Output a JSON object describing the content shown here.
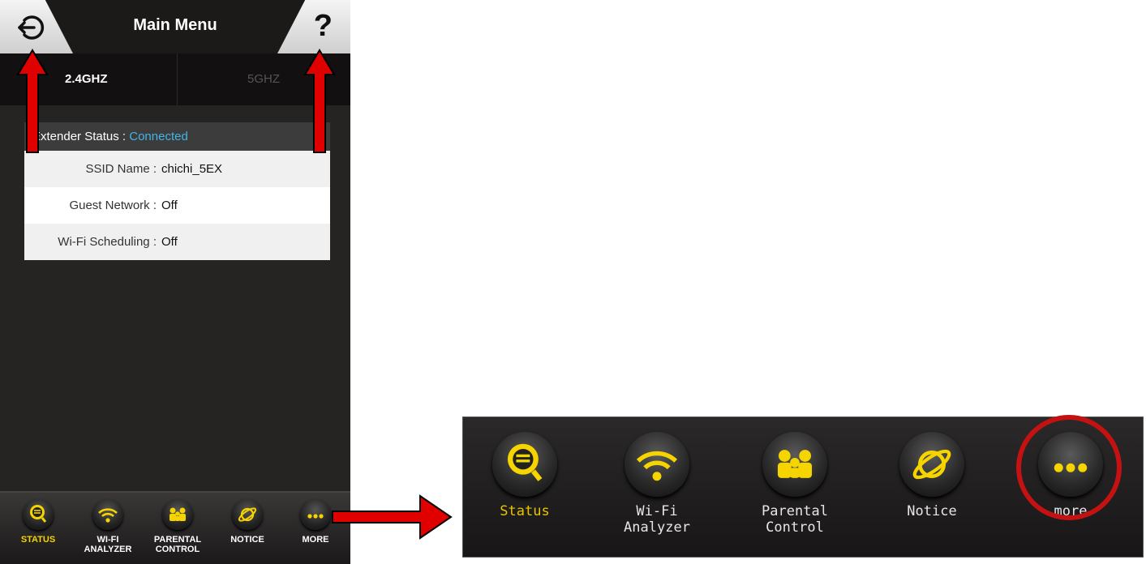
{
  "header": {
    "title": "Main Menu",
    "help_glyph": "?"
  },
  "bands": {
    "band1": "2.4GHZ",
    "band2": "5GHZ"
  },
  "status": {
    "heading_label": "Extender Status :",
    "heading_value": "Connected",
    "rows": [
      {
        "label": "SSID Name :",
        "value": "chichi_5EX"
      },
      {
        "label": "Guest Network :",
        "value": "Off"
      },
      {
        "label": "Wi-Fi Scheduling :",
        "value": "Off"
      }
    ]
  },
  "phone_nav": [
    {
      "label1": "STATUS",
      "label2": ""
    },
    {
      "label1": "WI-FI",
      "label2": "ANALYZER"
    },
    {
      "label1": "PARENTAL",
      "label2": "CONTROL"
    },
    {
      "label1": "NOTICE",
      "label2": ""
    },
    {
      "label1": "MORE",
      "label2": ""
    }
  ],
  "zoom_nav": [
    {
      "label1": "Status",
      "label2": ""
    },
    {
      "label1": "Wi-Fi",
      "label2": "Analyzer"
    },
    {
      "label1": "Parental",
      "label2": "Control"
    },
    {
      "label1": "Notice",
      "label2": ""
    },
    {
      "label1": "more",
      "label2": ""
    }
  ],
  "colors": {
    "accent_yellow": "#f5d400",
    "connected_blue": "#3fb6e6",
    "arrow_red": "#e00000",
    "highlight_ring": "#c41212"
  },
  "icons": [
    "back-icon",
    "help-icon",
    "status-icon",
    "wifi-icon",
    "parental-icon",
    "notice-icon",
    "more-icon"
  ]
}
